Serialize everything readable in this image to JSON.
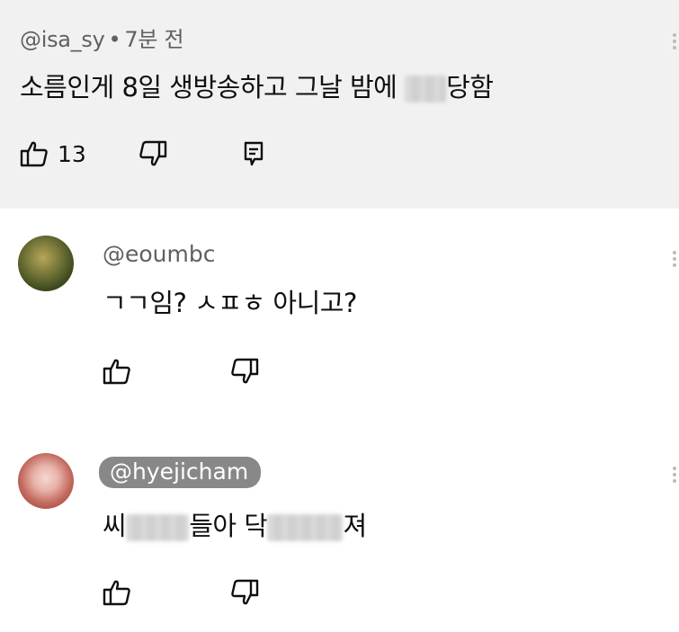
{
  "top_comment": {
    "username": "@isa_sy",
    "separator": "•",
    "time": "7분 전",
    "text_before_blur": "소름인게 8일 생방송하고 그날 밤에 ",
    "text_after_blur": "당함",
    "like_count": "13"
  },
  "replies": [
    {
      "username": "@eoumbc",
      "text": "ㄱㄱ임? ㅅㅍㅎ 아니고?"
    },
    {
      "username": "@hyejicham",
      "text_part1": "씨",
      "text_part2": "들아 닥",
      "text_part3": "져"
    }
  ],
  "icons": {
    "like": "thumbs-up-icon",
    "dislike": "thumbs-down-icon",
    "reply": "comment-reply-icon",
    "more": "more-vertical-icon"
  }
}
